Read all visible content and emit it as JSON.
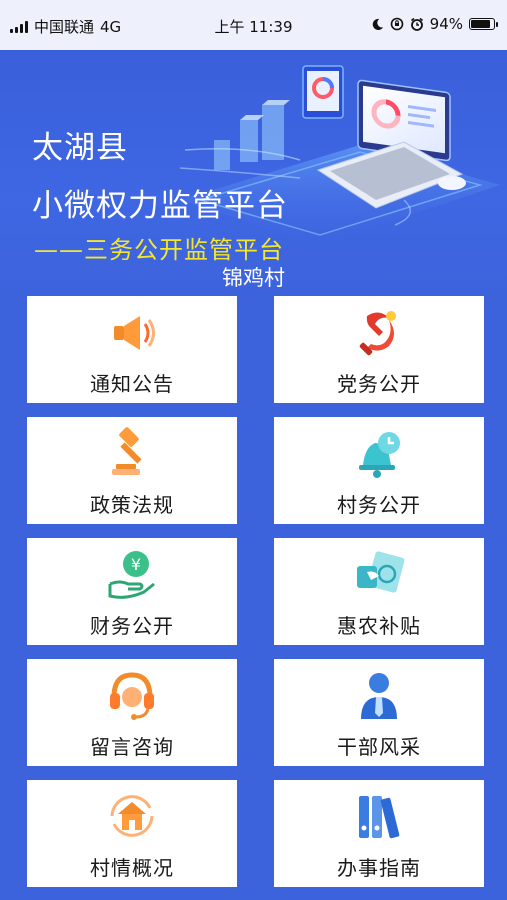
{
  "status_bar": {
    "carrier": "中国联通",
    "network": "4G",
    "time": "上午 11:39",
    "battery_percent": "94%",
    "battery_level": 0.94
  },
  "banner": {
    "county": "太湖县",
    "platform_title": "小微权力监管平台",
    "subtitle": "——三务公开监管平台",
    "village": "锦鸡村",
    "colors": {
      "background": "#3d63dc",
      "subtitle": "#f5e62c"
    }
  },
  "menu": [
    {
      "label": "通知公告",
      "icon": "megaphone-icon"
    },
    {
      "label": "党务公开",
      "icon": "party-emblem-icon"
    },
    {
      "label": "政策法规",
      "icon": "gavel-icon"
    },
    {
      "label": "村务公开",
      "icon": "bell-clock-icon"
    },
    {
      "label": "财务公开",
      "icon": "money-hand-icon"
    },
    {
      "label": "惠农补贴",
      "icon": "subsidy-card-icon"
    },
    {
      "label": "留言咨询",
      "icon": "headset-icon"
    },
    {
      "label": "干部风采",
      "icon": "cadre-icon"
    },
    {
      "label": "村情概况",
      "icon": "house-icon"
    },
    {
      "label": "办事指南",
      "icon": "binders-icon"
    }
  ]
}
